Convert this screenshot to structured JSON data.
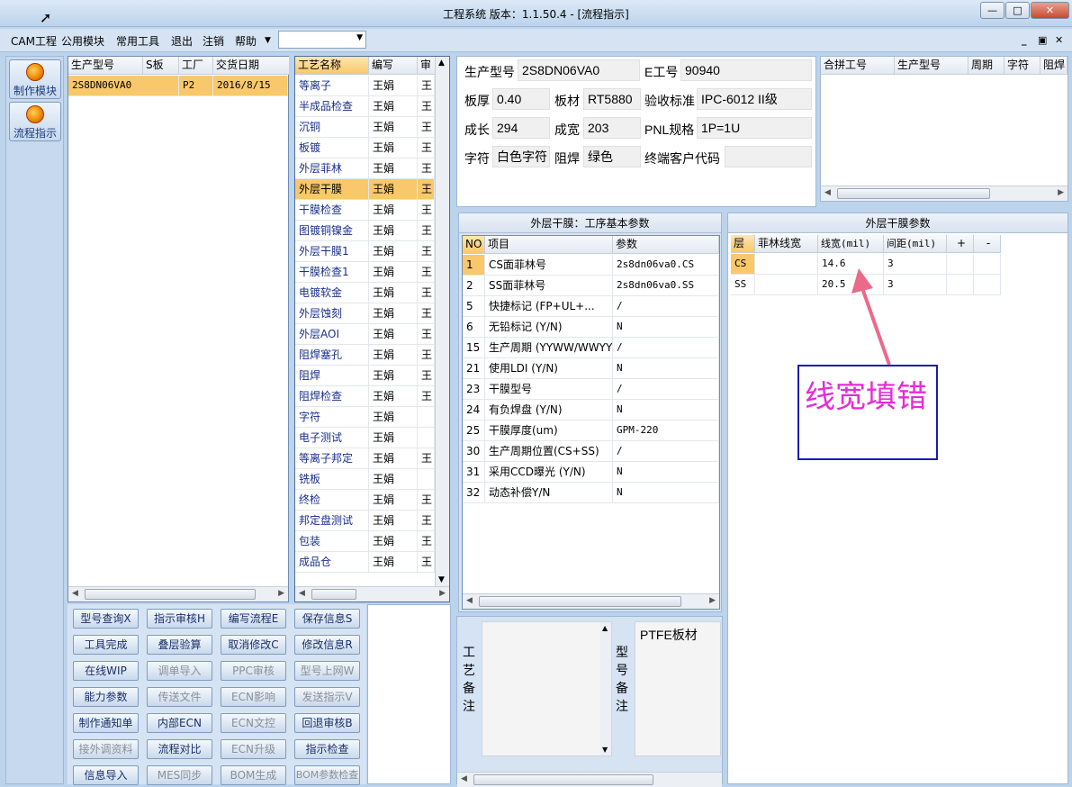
{
  "window": {
    "title": "工程系统   版本：1.1.50.4 - [流程指示]",
    "minimize": "—",
    "maximize": "□",
    "close": "✕"
  },
  "menu": {
    "items": [
      "CAM工程",
      "公用模块",
      "常用工具",
      "退出",
      "注销",
      "帮助"
    ],
    "combo_value": ""
  },
  "nav": {
    "make_module": "制作模块",
    "flow_guide": "流程指示"
  },
  "orders": {
    "headers": [
      "生产型号",
      "S板",
      "工厂",
      "交货日期"
    ],
    "rows": [
      {
        "model": "2S8DN06VA0",
        "s_board": "",
        "factory": "P2",
        "delivery": "2016/8/15"
      }
    ]
  },
  "process": {
    "headers": [
      "工艺名称",
      "编写",
      "审"
    ],
    "rows": [
      {
        "name": "等离子",
        "author": "王娟",
        "rev": "王"
      },
      {
        "name": "半成品检查",
        "author": "王娟",
        "rev": "王"
      },
      {
        "name": "沉铜",
        "author": "王娟",
        "rev": "王"
      },
      {
        "name": "板镀",
        "author": "王娟",
        "rev": "王"
      },
      {
        "name": "外层菲林",
        "author": "王娟",
        "rev": "王"
      },
      {
        "name": "外层干膜",
        "author": "王娟",
        "rev": "王"
      },
      {
        "name": "干膜检查",
        "author": "王娟",
        "rev": "王"
      },
      {
        "name": "图镀铜镍金",
        "author": "王娟",
        "rev": "王"
      },
      {
        "name": "外层干膜1",
        "author": "王娟",
        "rev": "王"
      },
      {
        "name": "干膜检查1",
        "author": "王娟",
        "rev": "王"
      },
      {
        "name": "电镀软金",
        "author": "王娟",
        "rev": "王"
      },
      {
        "name": "外层蚀刻",
        "author": "王娟",
        "rev": "王"
      },
      {
        "name": "外层AOI",
        "author": "王娟",
        "rev": "王"
      },
      {
        "name": "阻焊塞孔",
        "author": "王娟",
        "rev": "王"
      },
      {
        "name": "阻焊",
        "author": "王娟",
        "rev": "王"
      },
      {
        "name": "阻焊检查",
        "author": "王娟",
        "rev": "王"
      },
      {
        "name": "字符",
        "author": "王娟",
        "rev": ""
      },
      {
        "name": "电子测试",
        "author": "王娟",
        "rev": ""
      },
      {
        "name": "等离子邦定",
        "author": "王娟",
        "rev": "王"
      },
      {
        "name": "铣板",
        "author": "王娟",
        "rev": ""
      },
      {
        "name": "终检",
        "author": "王娟",
        "rev": "王"
      },
      {
        "name": "邦定盘测试",
        "author": "王娟",
        "rev": "王"
      },
      {
        "name": "包装",
        "author": "王娟",
        "rev": "王"
      },
      {
        "name": "成品仓",
        "author": "王娟",
        "rev": "王"
      }
    ]
  },
  "buttons": [
    {
      "label": "型号查询X",
      "enabled": true
    },
    {
      "label": "指示审核H",
      "enabled": true
    },
    {
      "label": "编写流程E",
      "enabled": true
    },
    {
      "label": "保存信息S",
      "enabled": true
    },
    {
      "label": "工具完成",
      "enabled": true
    },
    {
      "label": "叠层验算",
      "enabled": true
    },
    {
      "label": "取消修改C",
      "enabled": true
    },
    {
      "label": "修改信息R",
      "enabled": true
    },
    {
      "label": "在线WIP",
      "enabled": true
    },
    {
      "label": "调单导入",
      "enabled": false
    },
    {
      "label": "PPC审核",
      "enabled": false
    },
    {
      "label": "型号上网W",
      "enabled": false
    },
    {
      "label": "能力参数",
      "enabled": true
    },
    {
      "label": "传送文件",
      "enabled": false
    },
    {
      "label": "ECN影响",
      "enabled": false
    },
    {
      "label": "发送指示V",
      "enabled": false
    },
    {
      "label": "制作通知单",
      "enabled": true
    },
    {
      "label": "内部ECN",
      "enabled": true
    },
    {
      "label": "ECN文控",
      "enabled": false
    },
    {
      "label": "回退审核B",
      "enabled": true
    },
    {
      "label": "接外调资料",
      "enabled": false
    },
    {
      "label": "流程对比",
      "enabled": true
    },
    {
      "label": "ECN升级",
      "enabled": false
    },
    {
      "label": "指示检查",
      "enabled": true
    },
    {
      "label": "信息导入",
      "enabled": true
    },
    {
      "label": "MES同步",
      "enabled": false
    },
    {
      "label": "BOM生成",
      "enabled": false
    },
    {
      "label": "BOM参数检查",
      "enabled": false
    }
  ],
  "info": {
    "model_label": "生产型号",
    "model_value": "2S8DN06VA0",
    "e_label": "E工号",
    "e_value": "90940",
    "thickness_label": "板厚",
    "thickness_value": "0.40",
    "material_label": "板材",
    "material_value": "RT5880",
    "standard_label": "验收标准",
    "standard_value": "IPC-6012 II级",
    "length_label": "成长",
    "length_value": "294",
    "width_label": "成宽",
    "width_value": "203",
    "pnl_label": "PNL规格",
    "pnl_value": "1P=1U",
    "char_label": "字符",
    "char_value": "白色字符",
    "mask_label": "阻焊",
    "mask_value": "绿色",
    "cust_label": "终端客户代码",
    "cust_value": ""
  },
  "merge": {
    "headers": [
      "合拼工号",
      "生产型号",
      "周期",
      "字符",
      "阻焊"
    ]
  },
  "params": {
    "caption": "外层干膜：工序基本参数",
    "headers": [
      "NO",
      "项目",
      "参数"
    ],
    "rows": [
      {
        "no": "1",
        "item": "CS面菲林号",
        "value": "2s8dn06va0.CS"
      },
      {
        "no": "2",
        "item": "SS面菲林号",
        "value": "2s8dn06va0.SS"
      },
      {
        "no": "5",
        "item": "快捷标记 (FP+UL+...",
        "value": "/"
      },
      {
        "no": "6",
        "item": "无铅标记 (Y/N)",
        "value": "N"
      },
      {
        "no": "15",
        "item": "生产周期 (YYWW/WWYY)",
        "value": "/"
      },
      {
        "no": "21",
        "item": "使用LDI (Y/N)",
        "value": "N"
      },
      {
        "no": "23",
        "item": "干膜型号",
        "value": "/"
      },
      {
        "no": "24",
        "item": "有负焊盘 (Y/N)",
        "value": "N"
      },
      {
        "no": "25",
        "item": "干膜厚度(um)",
        "value": "GPM-220"
      },
      {
        "no": "30",
        "item": "生产周期位置(CS+SS)",
        "value": "/"
      },
      {
        "no": "31",
        "item": "采用CCD曝光 (Y/N)",
        "value": "N"
      },
      {
        "no": "32",
        "item": "动态补偿Y/N",
        "value": "N"
      }
    ]
  },
  "film": {
    "caption": "外层干膜参数",
    "headers": [
      "层",
      "菲林线宽",
      "线宽(mil)",
      "间距(mil)",
      "+",
      "-"
    ],
    "rows": [
      {
        "layer": "CS",
        "film_width": "",
        "width": "14.6",
        "spacing": "3"
      },
      {
        "layer": "SS",
        "film_width": "",
        "width": "20.5",
        "spacing": "3"
      }
    ]
  },
  "remarks": {
    "process_label": "工艺备注",
    "model_label": "型号备注",
    "model_text": "PTFE板材"
  },
  "annotation": {
    "text": "线宽填错",
    "color": "#e52bd6"
  }
}
